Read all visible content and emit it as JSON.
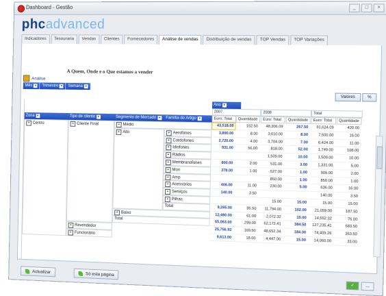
{
  "window": {
    "title": "Dashboard - Gestão",
    "controls": [
      "_",
      "□",
      "×"
    ]
  },
  "logo": {
    "part1": "phc",
    "part2": "advanced"
  },
  "tabs": [
    {
      "label": "Indicadores",
      "active": false
    },
    {
      "label": "Tesouraria",
      "active": false
    },
    {
      "label": "Vendas",
      "active": false
    },
    {
      "label": "Clientes",
      "active": false
    },
    {
      "label": "Fornecedores",
      "active": false
    },
    {
      "label": "Análise de vendas",
      "active": true
    },
    {
      "label": "Distribuição de vendas",
      "active": false
    },
    {
      "label": "TOP Vendas",
      "active": false
    },
    {
      "label": "TOP Variações",
      "active": false
    }
  ],
  "heading": "A Quem, Onde e o Que estamos a vender",
  "analysis_label": "Análise",
  "dimension_filters": [
    "Mês",
    "Trimestre",
    "Semana"
  ],
  "buttons": {
    "right_a": "Valores",
    "right_b": "%",
    "refresh": "Actualizar",
    "this_page": "Só esta página"
  },
  "pivot": {
    "column_dim": "Ano",
    "row_dims": [
      "Zona",
      "Tipo de cliente",
      "Segmento de Mercado",
      "Família do Artigo"
    ],
    "years": [
      "2007",
      "2008",
      "Total"
    ],
    "measures": [
      "Euro: Total",
      "Quantidade",
      "Euro: Total",
      "Quantidade",
      "Euro: Total",
      "Quantidade"
    ],
    "zona": "Centro",
    "tipo_cliente": "Cliente Final",
    "segmentos": [
      "Médio",
      "Alto",
      "Baixo",
      "Total"
    ],
    "familias": [
      "Aerofones",
      "Cordofones",
      "Idiofones",
      "Rádios",
      "Membranofones",
      "Mon",
      "Amp",
      "Acessórios",
      "Serviços",
      "Pilhas",
      "Total"
    ],
    "other_tipos": [
      "Revendedor",
      "Funcionário"
    ],
    "rows": [
      [
        "43,518.00",
        "152.50",
        "48,306.09",
        "267.50",
        "91,624.09",
        "420.00"
      ],
      [
        "3,890.00",
        "8.00",
        "3,610.00",
        "8.00",
        "7,500.00",
        "16.00"
      ],
      [
        "2,720.00",
        "4.00",
        "3,704.00",
        "7.00",
        "6,424.00",
        "11.00"
      ],
      [
        "931.00",
        "56.00",
        "818.00",
        "52.00",
        "1,749.00",
        "108.00"
      ],
      [
        "",
        "",
        "1,509.00",
        "10.00",
        "1,509.00",
        "10.00"
      ],
      [
        "800.00",
        "2.00",
        "531.00",
        "3.00",
        "1,331.00",
        "5.00"
      ],
      [
        "378.00",
        "1.00",
        "527.00",
        "1.00",
        "905.00",
        "2.00"
      ],
      [
        "",
        "",
        "850.00",
        "1.00",
        "850.00",
        "1.00"
      ],
      [
        "406.00",
        "11.00",
        "230.00",
        "5.00",
        "636.00",
        "16.00"
      ],
      [
        "140.00",
        "3.50",
        "",
        "",
        "140.00",
        "3.50"
      ],
      [
        "",
        "",
        "15.00",
        "15.00",
        "15.00",
        "15.00"
      ],
      [
        "9,265.00",
        "85.50",
        "11,794.00",
        "102.00",
        "21,059.00",
        "187.50"
      ],
      [
        "12,480.00",
        "61.00",
        "2,072.32",
        "15.00",
        "14,552.32",
        "76.00"
      ],
      [
        "65,063.00",
        "299.00",
        "62,172.41",
        "384.50",
        "127,235.41",
        "683.50"
      ],
      [
        "25,756.92",
        "169.50",
        "48,652.34",
        "184.00",
        "74,409.26",
        "353.50"
      ],
      [
        "9,613.00",
        "18.00",
        "4,447.00",
        "15.00",
        "14,060.00",
        "33.00"
      ]
    ]
  }
}
